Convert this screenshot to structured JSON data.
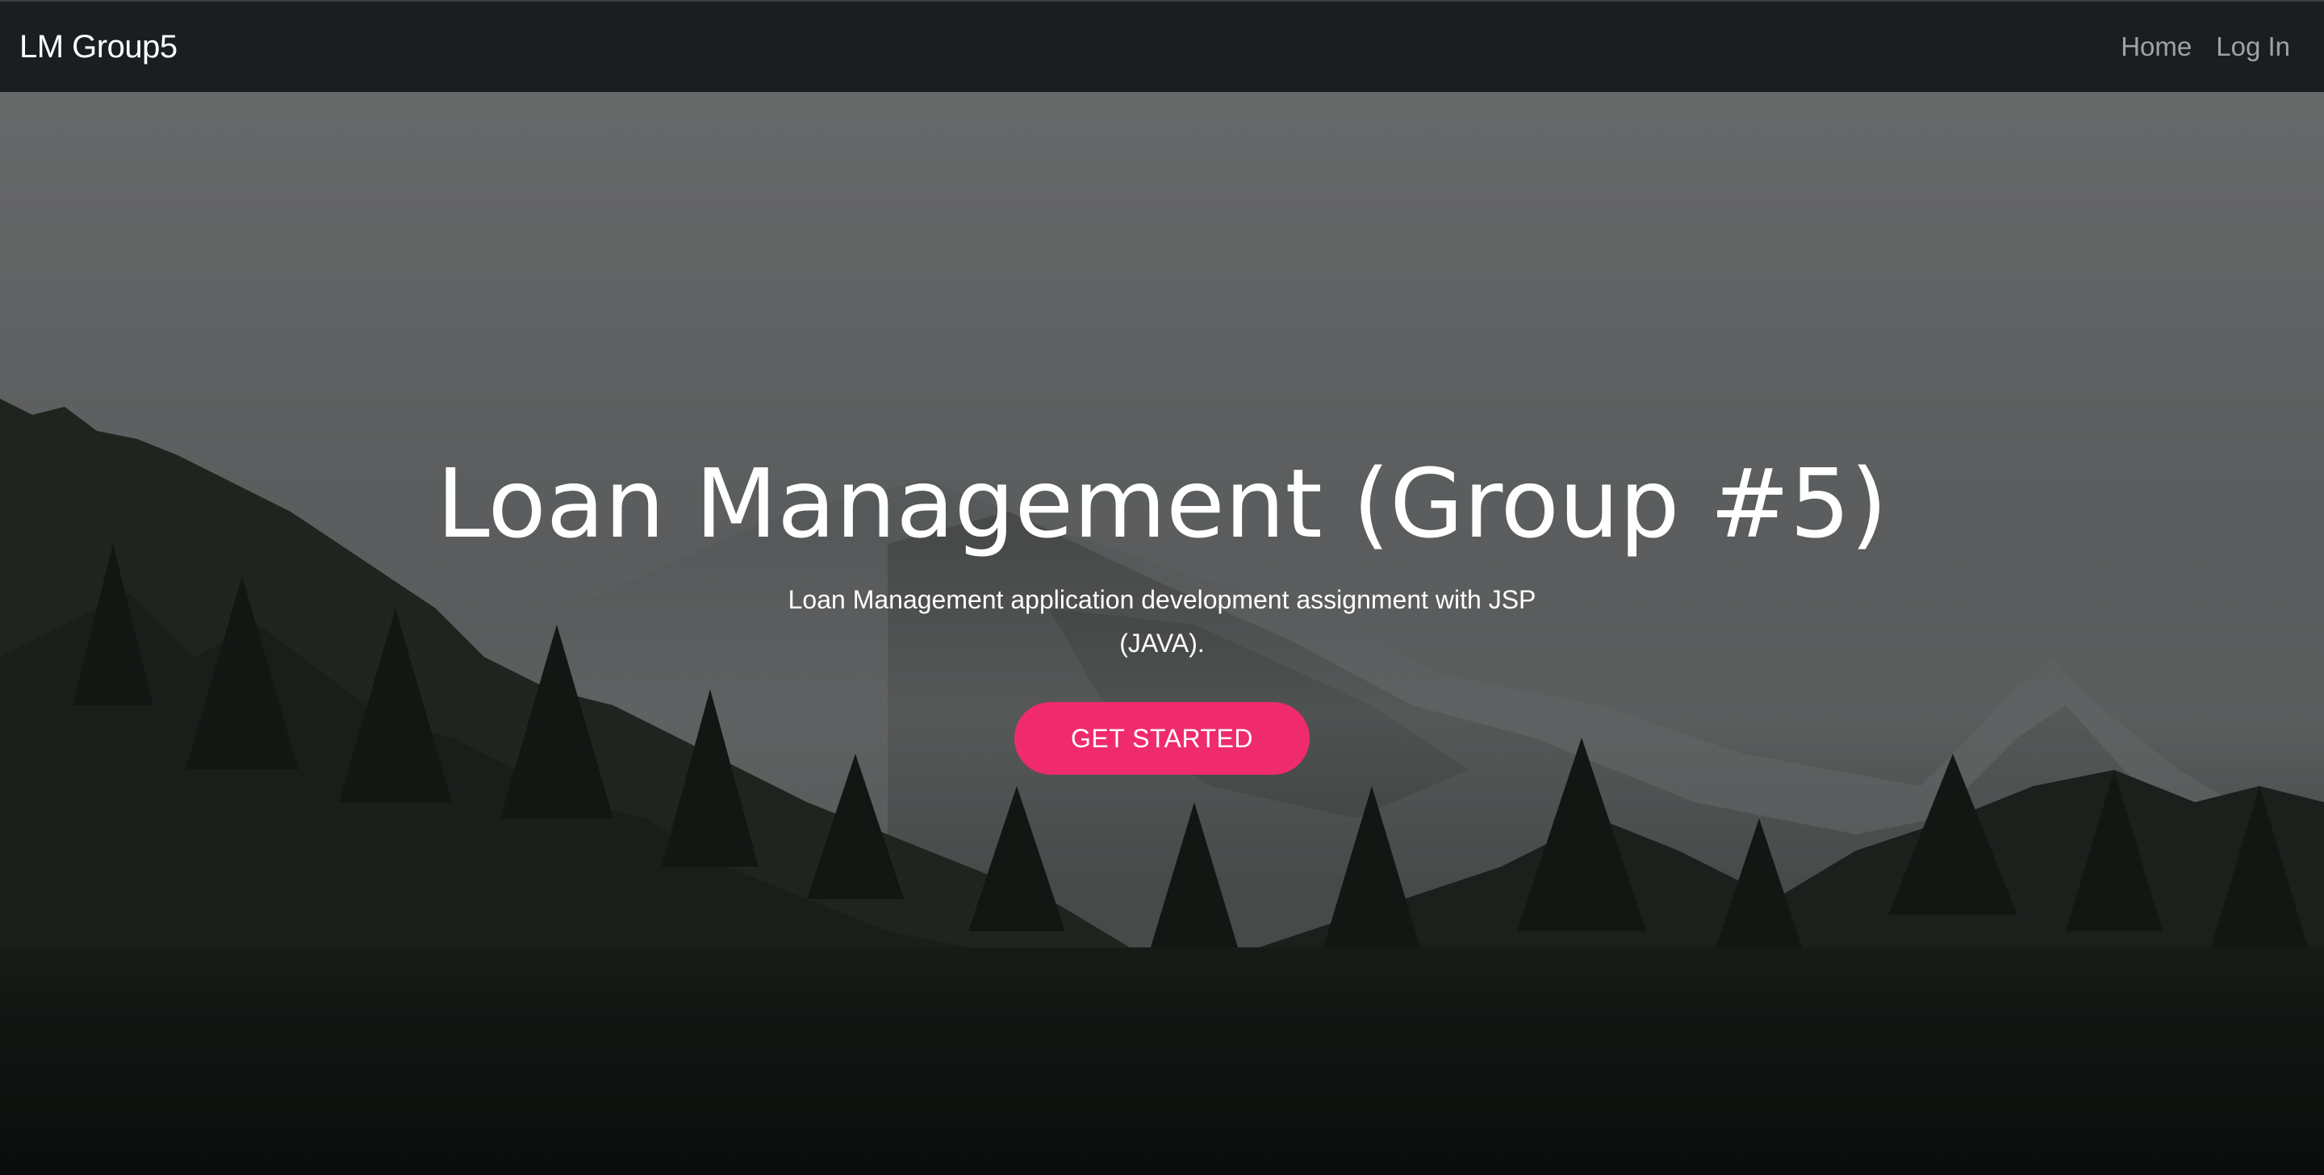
{
  "navbar": {
    "brand": "LM Group5",
    "links": [
      {
        "label": "Home"
      },
      {
        "label": "Log In"
      }
    ]
  },
  "hero": {
    "title": "Loan Management (Group #5)",
    "subtitle": "Loan Management application development assignment with JSP (JAVA).",
    "cta_label": "GET STARTED",
    "background_image": "misty-mountain-forest",
    "overlay_color": "#000000"
  },
  "colors": {
    "navbar_bg": "#1b1e21",
    "accent": "#ef2b6e",
    "nav_link": "#9ea3a8",
    "text": "#ffffff"
  }
}
